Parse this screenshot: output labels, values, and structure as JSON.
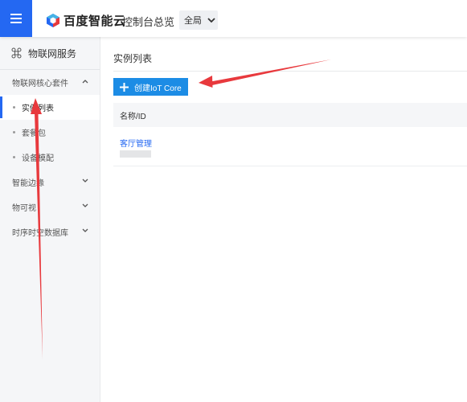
{
  "header": {
    "brand": "百度智能云",
    "console_link": "控制台总览",
    "region": "全局",
    "accent": "#2468f2"
  },
  "sidebar": {
    "title": "物联网服务",
    "groups": [
      {
        "label": "物联网核心套件",
        "expanded": true,
        "items": [
          {
            "label": "实例列表",
            "active": true
          },
          {
            "label": "套餐包",
            "active": false
          },
          {
            "label": "设备模配",
            "active": false
          }
        ]
      },
      {
        "label": "智能边缘",
        "expanded": false
      },
      {
        "label": "物可视",
        "expanded": false
      },
      {
        "label": "时序时空数据库",
        "expanded": false
      }
    ]
  },
  "main": {
    "title": "实例列表",
    "create_button": "创建IoT Core",
    "button_color": "#1c8ce5",
    "table": {
      "columns": [
        "名称/ID"
      ],
      "rows": [
        {
          "name": "客厅管理"
        }
      ]
    }
  },
  "annotations": {
    "arrow_color": "#e8393d"
  }
}
